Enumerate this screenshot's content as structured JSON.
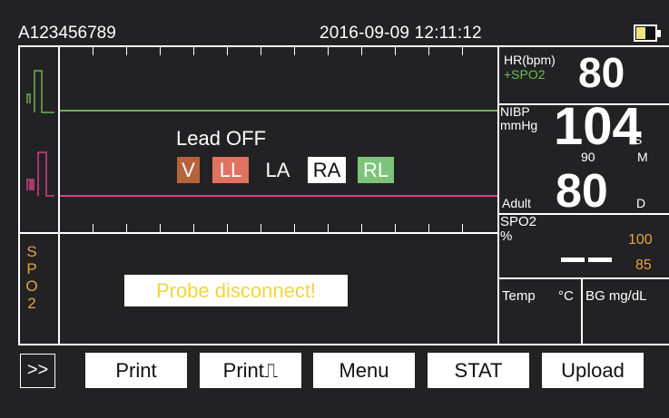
{
  "header": {
    "device_id": "A123456789",
    "datetime": "2016-09-09  12:11:12",
    "battery_level": 0.45
  },
  "ecg": {
    "status": "Lead OFF",
    "leads": [
      {
        "label": "V",
        "bg": "#b5633a",
        "fg": "#ffffff"
      },
      {
        "label": "LL",
        "bg": "#e0735f",
        "fg": "#ffffff"
      },
      {
        "label": "LA",
        "bg": "transparent",
        "fg": "#ffffff"
      },
      {
        "label": "RA",
        "bg": "#ffffff",
        "fg": "#111111"
      },
      {
        "label": "RL",
        "bg": "#7dc47a",
        "fg": "#ffffff"
      }
    ],
    "lead_labels": {
      "v": "V",
      "ll": "LL",
      "la": "LA",
      "ra": "RA",
      "rl": "RL"
    },
    "trace_colors": {
      "upper": "#6fb24b",
      "lower": "#d43f8a"
    }
  },
  "spo2_panel": {
    "title_letters": [
      "S",
      "P",
      "O",
      "2"
    ],
    "message": "Probe disconnect!"
  },
  "vitals": {
    "hr": {
      "label": "HR(bpm)",
      "sub": "+SPO2",
      "value": "80"
    },
    "nibp": {
      "label_line1": "NIBP",
      "label_line2": "mmHg",
      "systolic": "104",
      "s_label": "S",
      "mean": "90",
      "m_label": "M",
      "diastolic": "80",
      "d_label": "D",
      "patient": "Adult"
    },
    "spo2": {
      "label_line1": "SPO2",
      "label_line2": "%",
      "value": "--",
      "high": "100",
      "low": "85"
    },
    "temp": {
      "label": "Temp",
      "unit": "°C"
    },
    "bg": {
      "label": "BG mg/dL"
    }
  },
  "toolbar": {
    "more": ">>",
    "print": "Print",
    "print_wave": "Print⎍",
    "menu": "Menu",
    "stat": "STAT",
    "upload": "Upload"
  },
  "colors": {
    "background": "#222225",
    "accent_orange": "#e8a33a",
    "message_yellow": "#f2d63a",
    "spo2_green": "#66c24a"
  }
}
